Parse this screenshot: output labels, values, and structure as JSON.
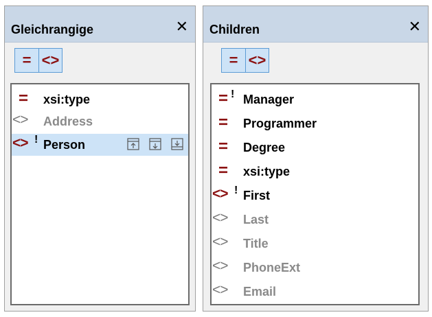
{
  "left_pane": {
    "title": "Gleichrangige",
    "close": "✕",
    "toggles": [
      "=",
      "<>"
    ],
    "items": [
      {
        "kind": "attribute",
        "label": "xsi:type",
        "required": false,
        "enabled": true
      },
      {
        "kind": "element",
        "label": "Address",
        "required": false,
        "enabled": false
      },
      {
        "kind": "element",
        "label": "Person",
        "required": true,
        "enabled": true,
        "selected": true
      }
    ],
    "row_tools": [
      "insert-before-icon",
      "append-icon",
      "add-child-icon"
    ]
  },
  "right_pane": {
    "title": "Children",
    "close": "✕",
    "toggles": [
      "=",
      "<>"
    ],
    "items": [
      {
        "kind": "attribute",
        "label": "Manager",
        "required": true,
        "enabled": true
      },
      {
        "kind": "attribute",
        "label": "Programmer",
        "required": false,
        "enabled": true
      },
      {
        "kind": "attribute",
        "label": "Degree",
        "required": false,
        "enabled": true
      },
      {
        "kind": "attribute",
        "label": "xsi:type",
        "required": false,
        "enabled": true
      },
      {
        "kind": "element",
        "label": "First",
        "required": true,
        "enabled": true
      },
      {
        "kind": "element",
        "label": "Last",
        "required": false,
        "enabled": false
      },
      {
        "kind": "element",
        "label": "Title",
        "required": false,
        "enabled": false
      },
      {
        "kind": "element",
        "label": "PhoneExt",
        "required": false,
        "enabled": false
      },
      {
        "kind": "element",
        "label": "Email",
        "required": false,
        "enabled": false
      }
    ],
    "required_marker": "!"
  },
  "colors": {
    "accent": "#8c1212",
    "titlebar": "#c9d7e7",
    "selection": "#cde3f7",
    "toggle_border": "#5b9bd5",
    "disabled_text": "#8a8a8a"
  }
}
